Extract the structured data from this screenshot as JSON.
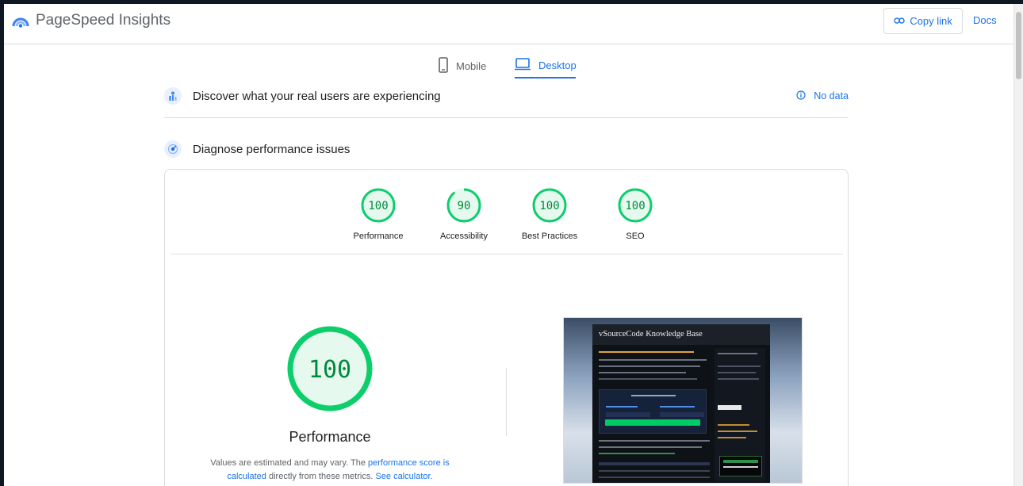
{
  "app": {
    "title": "PageSpeed Insights"
  },
  "header": {
    "copy_link_label": "Copy link",
    "docs_label": "Docs"
  },
  "tabs": [
    {
      "label": "Mobile",
      "active": false
    },
    {
      "label": "Desktop",
      "active": true
    }
  ],
  "field_section": {
    "title": "Discover what your real users are experiencing",
    "status": "No data"
  },
  "lab_section": {
    "title": "Diagnose performance issues"
  },
  "scores": [
    {
      "label": "Performance",
      "value": 100,
      "color": "#0cce6b"
    },
    {
      "label": "Accessibility",
      "value": 90,
      "color": "#0cce6b"
    },
    {
      "label": "Best Practices",
      "value": 100,
      "color": "#0cce6b"
    },
    {
      "label": "SEO",
      "value": 100,
      "color": "#0cce6b"
    }
  ],
  "performance": {
    "score": 100,
    "title": "Performance",
    "note_prefix": "Values are estimated and may vary. The ",
    "note_link1": "performance score is calculated",
    "note_mid": " directly from these metrics. ",
    "note_link2": "See calculator."
  },
  "screenshot": {
    "site_title": "vSourceCode Knowledge Base"
  },
  "colors": {
    "accent": "#1a73e8",
    "pass": "#0cce6b",
    "pass_fill": "#e6f9ee"
  }
}
